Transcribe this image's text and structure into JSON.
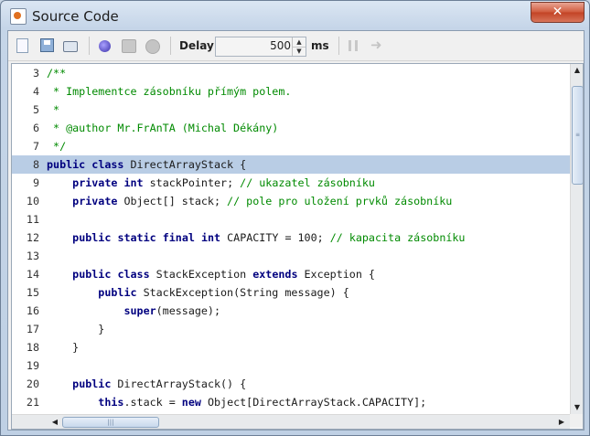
{
  "window": {
    "title": "Source Code",
    "close_label": "✕",
    "app_icon": "java-coffee-icon"
  },
  "toolbar": {
    "icons": [
      "new-file-icon",
      "save-icon",
      "print-icon",
      "run-globe-icon",
      "step-icon",
      "stop-icon",
      "pause-icon",
      "forward-arrow-icon"
    ],
    "delay_label": "Delay:",
    "delay_value": "500",
    "delay_unit": "ms",
    "spin_up": "▲",
    "spin_down": "▼"
  },
  "editor": {
    "highlighted_line": 8,
    "lines": [
      {
        "n": "3",
        "tokens": [
          {
            "t": "/**",
            "c": "cm"
          }
        ]
      },
      {
        "n": "4",
        "tokens": [
          {
            "t": " * Implementce zásobníku přímým polem.",
            "c": "cm"
          }
        ]
      },
      {
        "n": "5",
        "tokens": [
          {
            "t": " *",
            "c": "cm"
          }
        ]
      },
      {
        "n": "6",
        "tokens": [
          {
            "t": " * @author Mr.FrAnTA (Michal Dékány)",
            "c": "cm"
          }
        ]
      },
      {
        "n": "7",
        "tokens": [
          {
            "t": " */",
            "c": "cm"
          }
        ]
      },
      {
        "n": "8",
        "tokens": [
          {
            "t": "public",
            "c": "kw"
          },
          {
            "t": " ",
            "c": "src"
          },
          {
            "t": "class",
            "c": "kw"
          },
          {
            "t": " DirectArrayStack {",
            "c": "src"
          }
        ]
      },
      {
        "n": "9",
        "tokens": [
          {
            "t": "    ",
            "c": "src"
          },
          {
            "t": "private",
            "c": "kw"
          },
          {
            "t": " ",
            "c": "src"
          },
          {
            "t": "int",
            "c": "kw"
          },
          {
            "t": " stackPointer; ",
            "c": "src"
          },
          {
            "t": "// ukazatel zásobníku",
            "c": "cm"
          }
        ]
      },
      {
        "n": "10",
        "tokens": [
          {
            "t": "    ",
            "c": "src"
          },
          {
            "t": "private",
            "c": "kw"
          },
          {
            "t": " Object[] stack; ",
            "c": "src"
          },
          {
            "t": "// pole pro uložení prvků zásobníku",
            "c": "cm"
          }
        ]
      },
      {
        "n": "11",
        "tokens": []
      },
      {
        "n": "12",
        "tokens": [
          {
            "t": "    ",
            "c": "src"
          },
          {
            "t": "public",
            "c": "kw"
          },
          {
            "t": " ",
            "c": "src"
          },
          {
            "t": "static",
            "c": "kw"
          },
          {
            "t": " ",
            "c": "src"
          },
          {
            "t": "final",
            "c": "kw"
          },
          {
            "t": " ",
            "c": "src"
          },
          {
            "t": "int",
            "c": "kw"
          },
          {
            "t": " CAPACITY = 100; ",
            "c": "src"
          },
          {
            "t": "// kapacita zásobníku",
            "c": "cm"
          }
        ]
      },
      {
        "n": "13",
        "tokens": []
      },
      {
        "n": "14",
        "tokens": [
          {
            "t": "    ",
            "c": "src"
          },
          {
            "t": "public",
            "c": "kw"
          },
          {
            "t": " ",
            "c": "src"
          },
          {
            "t": "class",
            "c": "kw"
          },
          {
            "t": " StackException ",
            "c": "src"
          },
          {
            "t": "extends",
            "c": "kw"
          },
          {
            "t": " Exception {",
            "c": "src"
          }
        ]
      },
      {
        "n": "15",
        "tokens": [
          {
            "t": "        ",
            "c": "src"
          },
          {
            "t": "public",
            "c": "kw"
          },
          {
            "t": " StackException(String message) {",
            "c": "src"
          }
        ]
      },
      {
        "n": "16",
        "tokens": [
          {
            "t": "            ",
            "c": "src"
          },
          {
            "t": "super",
            "c": "kw"
          },
          {
            "t": "(message);",
            "c": "src"
          }
        ]
      },
      {
        "n": "17",
        "tokens": [
          {
            "t": "        }",
            "c": "src"
          }
        ]
      },
      {
        "n": "18",
        "tokens": [
          {
            "t": "    }",
            "c": "src"
          }
        ]
      },
      {
        "n": "19",
        "tokens": []
      },
      {
        "n": "20",
        "tokens": [
          {
            "t": "    ",
            "c": "src"
          },
          {
            "t": "public",
            "c": "kw"
          },
          {
            "t": " DirectArrayStack() {",
            "c": "src"
          }
        ]
      },
      {
        "n": "21",
        "tokens": [
          {
            "t": "        ",
            "c": "src"
          },
          {
            "t": "this",
            "c": "kw"
          },
          {
            "t": ".stack = ",
            "c": "src"
          },
          {
            "t": "new",
            "c": "kw"
          },
          {
            "t": " Object[DirectArrayStack.CAPACITY];",
            "c": "src"
          }
        ]
      }
    ]
  },
  "scrollbars": {
    "vertical_position": 0.0,
    "horizontal_position": 0.0
  }
}
